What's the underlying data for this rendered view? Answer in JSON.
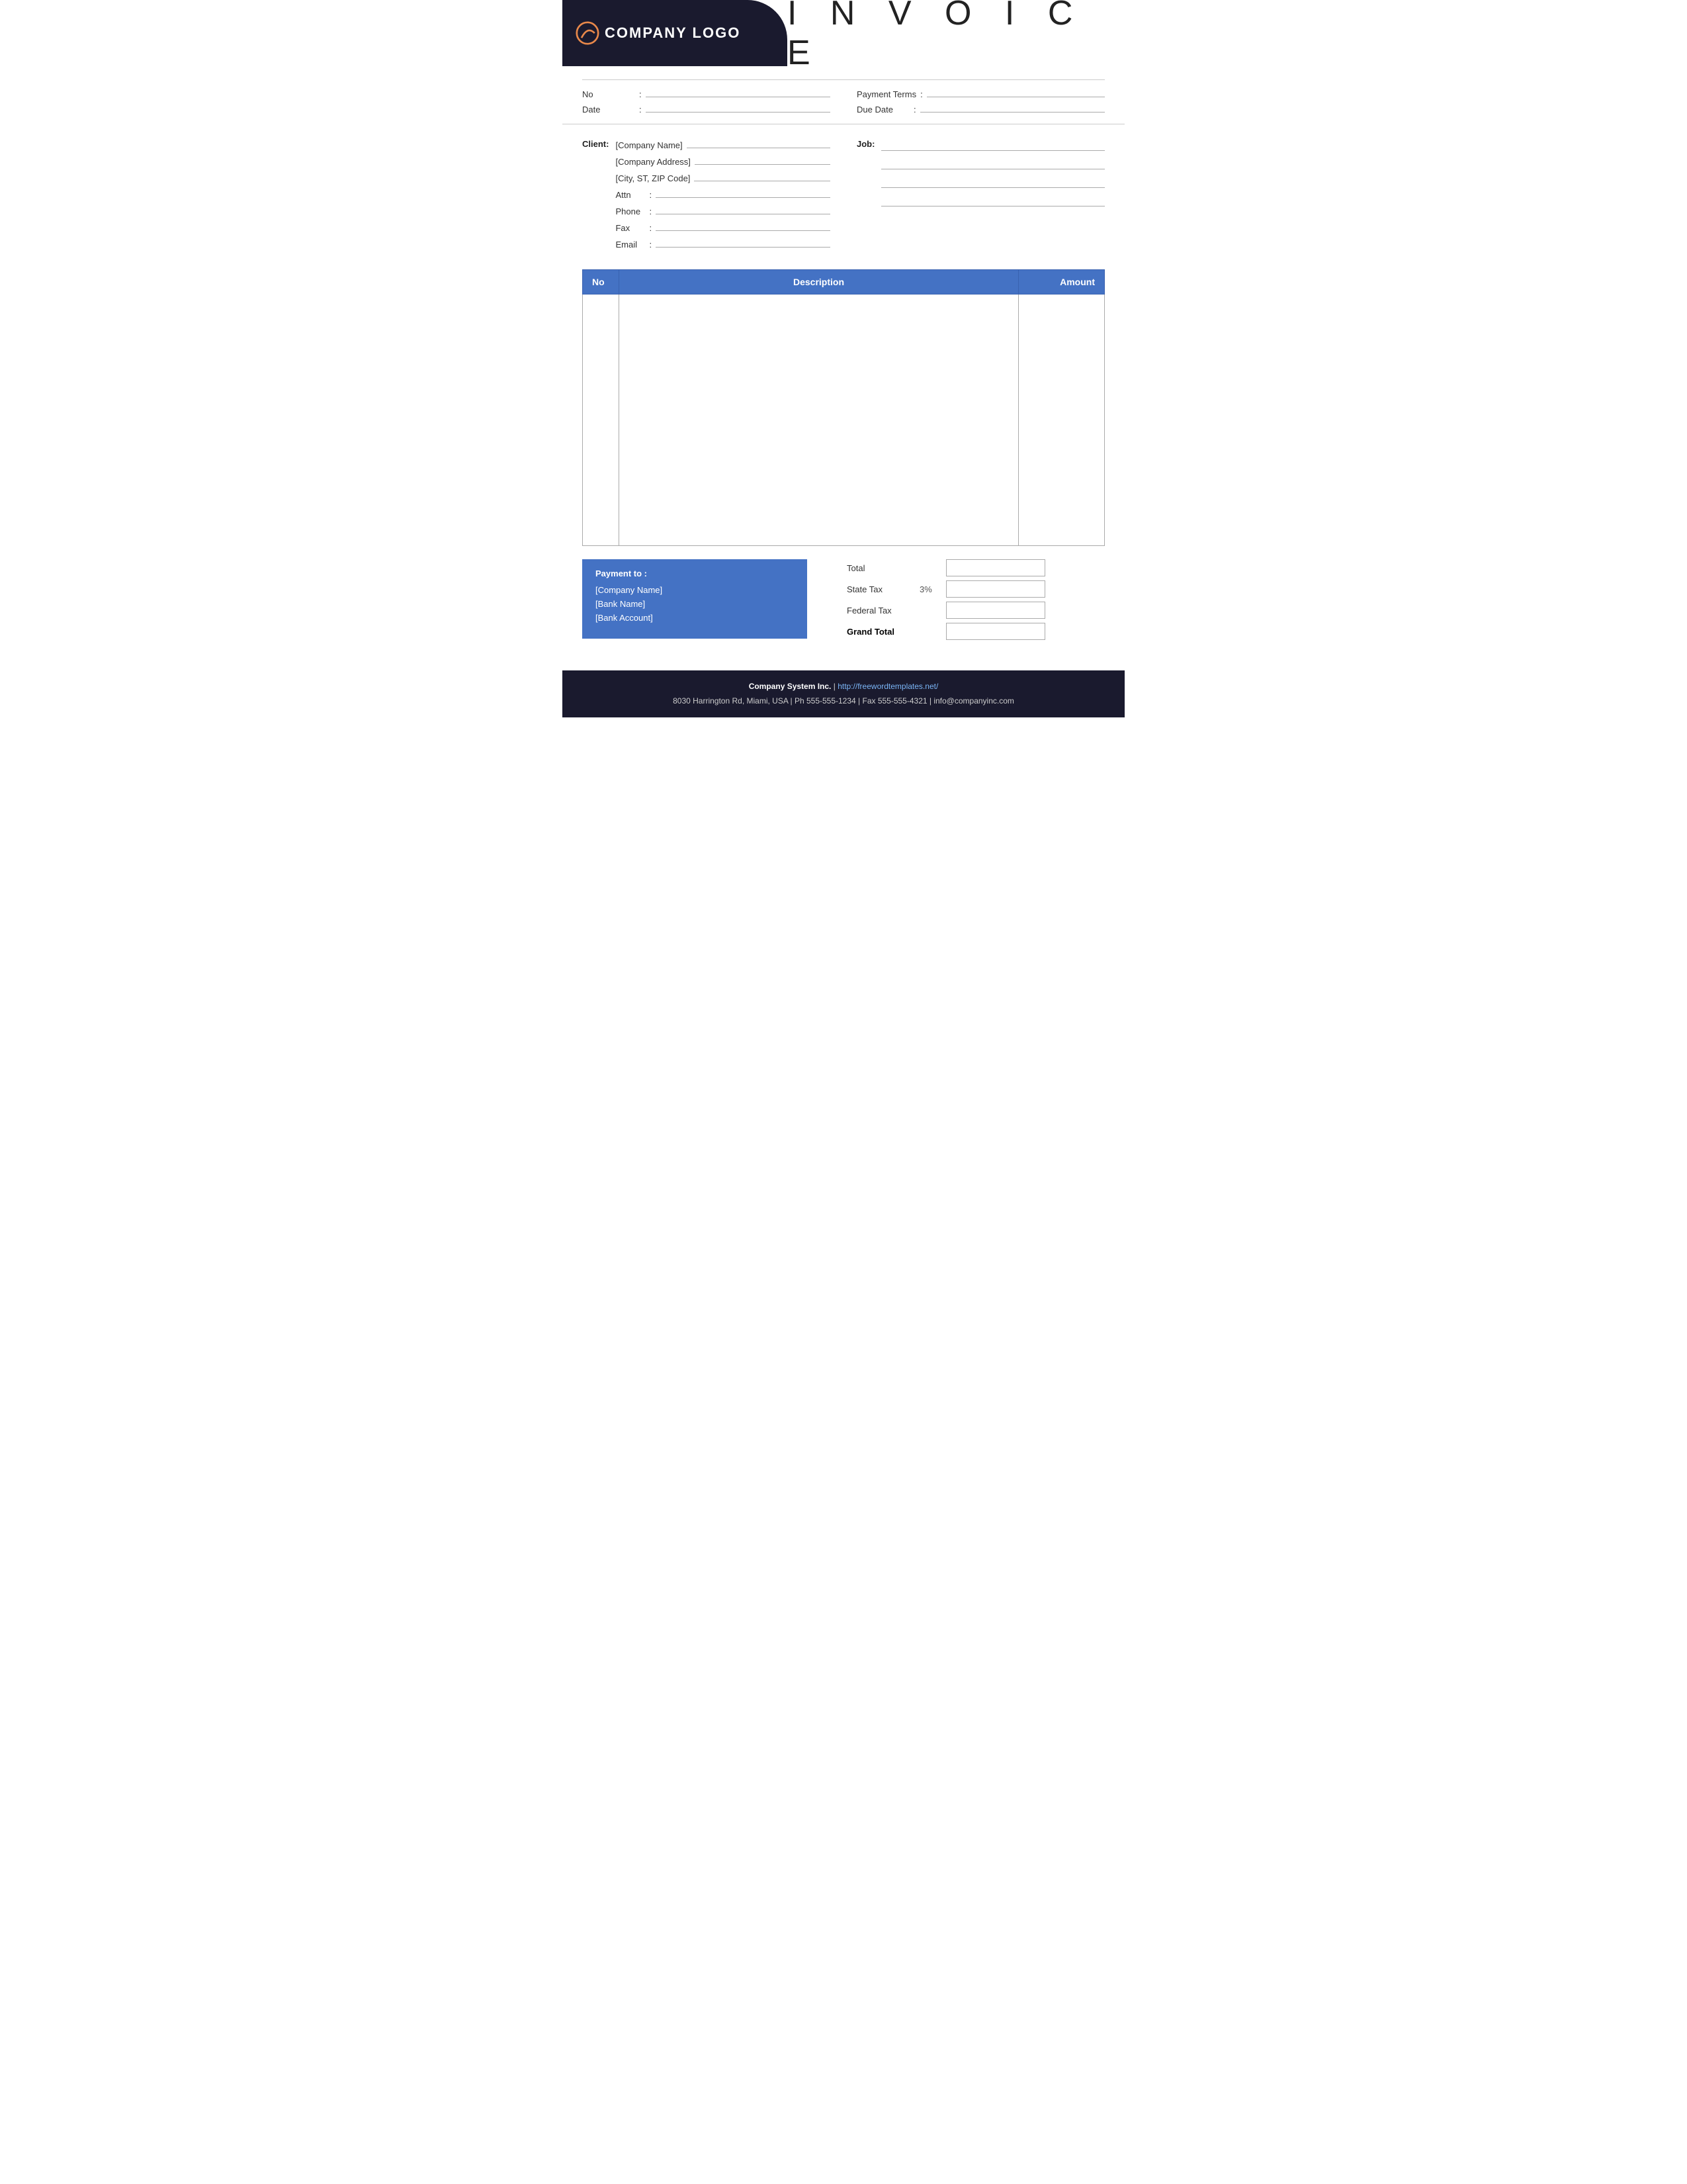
{
  "header": {
    "logo_text": "COMPANY LOGO",
    "invoice_title": "I N V O I C E"
  },
  "meta": {
    "no_label": "No",
    "no_colon": ":",
    "date_label": "Date",
    "date_colon": ":",
    "payment_terms_label": "Payment  Terms",
    "payment_terms_colon": ":",
    "due_date_label": "Due Date",
    "due_date_colon": ":"
  },
  "client": {
    "label": "Client",
    "colon": ":",
    "company_name": "[Company Name]",
    "company_address": "[Company Address]",
    "city_zip": "[City, ST, ZIP Code]",
    "attn_label": "Attn",
    "attn_colon": ":",
    "phone_label": "Phone",
    "phone_colon": ":",
    "fax_label": "Fax",
    "fax_colon": ":",
    "email_label": "Email",
    "email_colon": ":"
  },
  "job": {
    "label": "Job",
    "colon": ":"
  },
  "table": {
    "col_no": "No",
    "col_description": "Description",
    "col_amount": "Amount"
  },
  "payment": {
    "title": "Payment to :",
    "company_name": "[Company Name]",
    "bank_name": "[Bank Name]",
    "bank_account": "[Bank Account]"
  },
  "totals": {
    "total_label": "Total",
    "state_tax_label": "State Tax",
    "state_tax_percent": "3%",
    "federal_tax_label": "Federal Tax",
    "grand_total_label": "Grand Total"
  },
  "footer": {
    "company": "Company System Inc.",
    "separator": "|",
    "website": "http://freewordtemplates.net/",
    "address": "8030 Harrington Rd, Miami, USA | Ph 555-555-1234 | Fax 555-555-4321 | info@companyinc.com"
  }
}
